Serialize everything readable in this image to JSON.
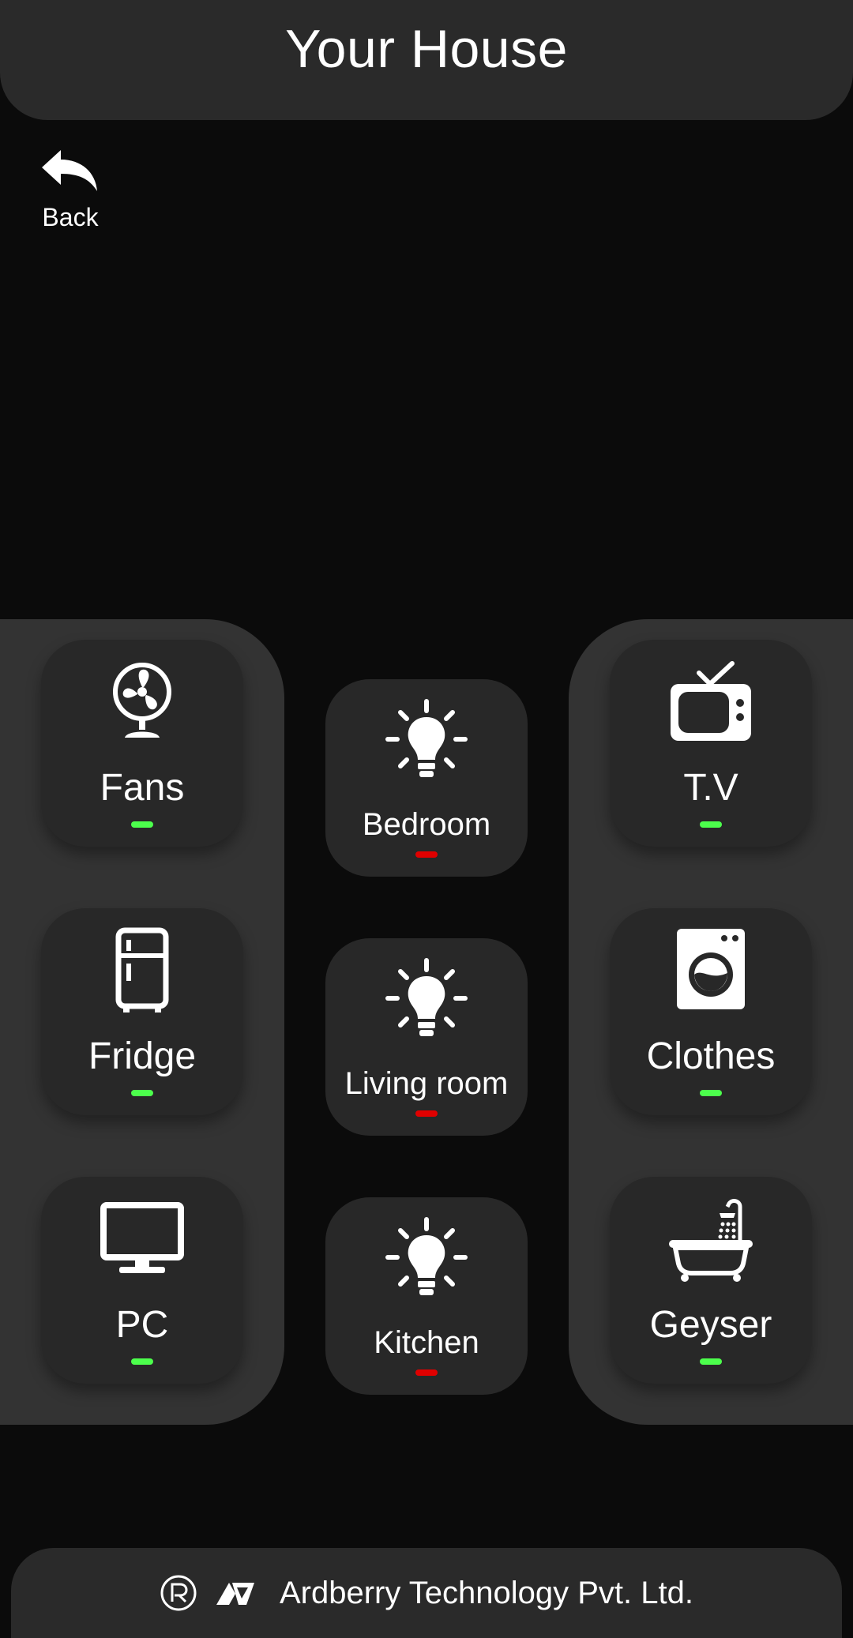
{
  "header": {
    "title": "Your House"
  },
  "back": {
    "label": "Back"
  },
  "colors": {
    "on": "#4cff4c",
    "off": "#e00000"
  },
  "devices_left": [
    {
      "label": "Fans",
      "icon": "fan-icon",
      "state": "on"
    },
    {
      "label": "Fridge",
      "icon": "fridge-icon",
      "state": "on"
    },
    {
      "label": "PC",
      "icon": "monitor-icon",
      "state": "on"
    }
  ],
  "rooms": [
    {
      "label": "Bedroom",
      "icon": "lightbulb-icon",
      "state": "off"
    },
    {
      "label": "Living room",
      "icon": "lightbulb-icon",
      "state": "off"
    },
    {
      "label": "Kitchen",
      "icon": "lightbulb-icon",
      "state": "off"
    }
  ],
  "devices_right": [
    {
      "label": "T.V",
      "icon": "tv-icon",
      "state": "on"
    },
    {
      "label": "Clothes",
      "icon": "washing-machine-icon",
      "state": "on"
    },
    {
      "label": "Geyser",
      "icon": "bathtub-icon",
      "state": "on"
    }
  ],
  "footer": {
    "company": "Ardberry Technology Pvt. Ltd."
  }
}
